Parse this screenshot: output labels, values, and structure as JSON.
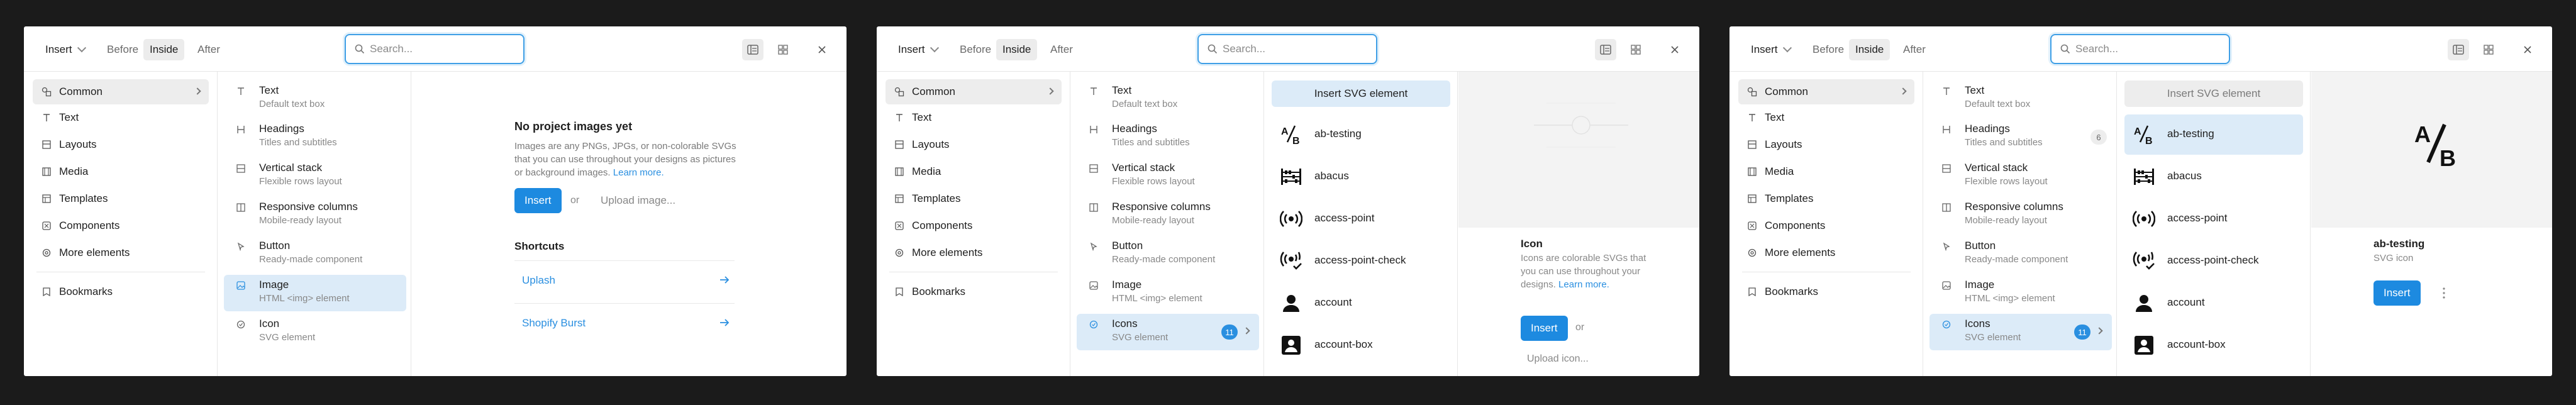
{
  "header": {
    "insert_label": "Insert",
    "positions": [
      "Before",
      "Inside",
      "After"
    ],
    "active_position": "Inside",
    "search_placeholder": "Search..."
  },
  "categories": [
    {
      "label": "Common",
      "icon": "shapes-icon"
    },
    {
      "label": "Text",
      "icon": "text-icon"
    },
    {
      "label": "Layouts",
      "icon": "layout-icon"
    },
    {
      "label": "Media",
      "icon": "media-icon"
    },
    {
      "label": "Templates",
      "icon": "template-icon"
    },
    {
      "label": "Components",
      "icon": "component-icon"
    },
    {
      "label": "More elements",
      "icon": "more-elements-icon"
    }
  ],
  "bookmarks_label": "Bookmarks",
  "elements": [
    {
      "title": "Text",
      "sub": "Default text box"
    },
    {
      "title": "Headings",
      "sub": "Titles and subtitles"
    },
    {
      "title": "Vertical stack",
      "sub": "Flexible rows layout"
    },
    {
      "title": "Responsive columns",
      "sub": "Mobile-ready layout"
    },
    {
      "title": "Button",
      "sub": "Ready-made component"
    },
    {
      "title": "Image",
      "sub": "HTML <img> element"
    },
    {
      "title": "Icon",
      "sub": "SVG element"
    }
  ],
  "icons_element": {
    "title": "Icons",
    "sub": "SVG element",
    "count": "11"
  },
  "headings_count": "6",
  "panel1": {
    "title": "No project images yet",
    "desc": "Images are any PNGs, JPGs, or non-colorable SVGs that you can use throughout your designs as pictures or background images.",
    "learn_more": "Learn more.",
    "insert_btn": "Insert",
    "or": "or",
    "upload": "Upload image...",
    "shortcuts_title": "Shortcuts",
    "shortcuts": [
      "Uplash",
      "Shopify Burst"
    ]
  },
  "icon_list": {
    "insert_svg": "Insert SVG element",
    "items": [
      "ab-testing",
      "abacus",
      "access-point",
      "access-point-check",
      "account",
      "account-box"
    ]
  },
  "panel2": {
    "title": "Icon",
    "desc": "Icons are colorable SVGs that you can use throughout your designs.",
    "learn_more": "Learn more.",
    "insert_btn": "Insert",
    "or": "or",
    "upload": "Upload icon..."
  },
  "panel3": {
    "title": "ab-testing",
    "sub": "SVG icon",
    "insert_btn": "Insert",
    "preview_glyph": "A/B"
  },
  "colors": {
    "accent": "#1d8ae0",
    "selected_bg": "#dcebf8",
    "focus_ring": "#3f9fe6"
  }
}
